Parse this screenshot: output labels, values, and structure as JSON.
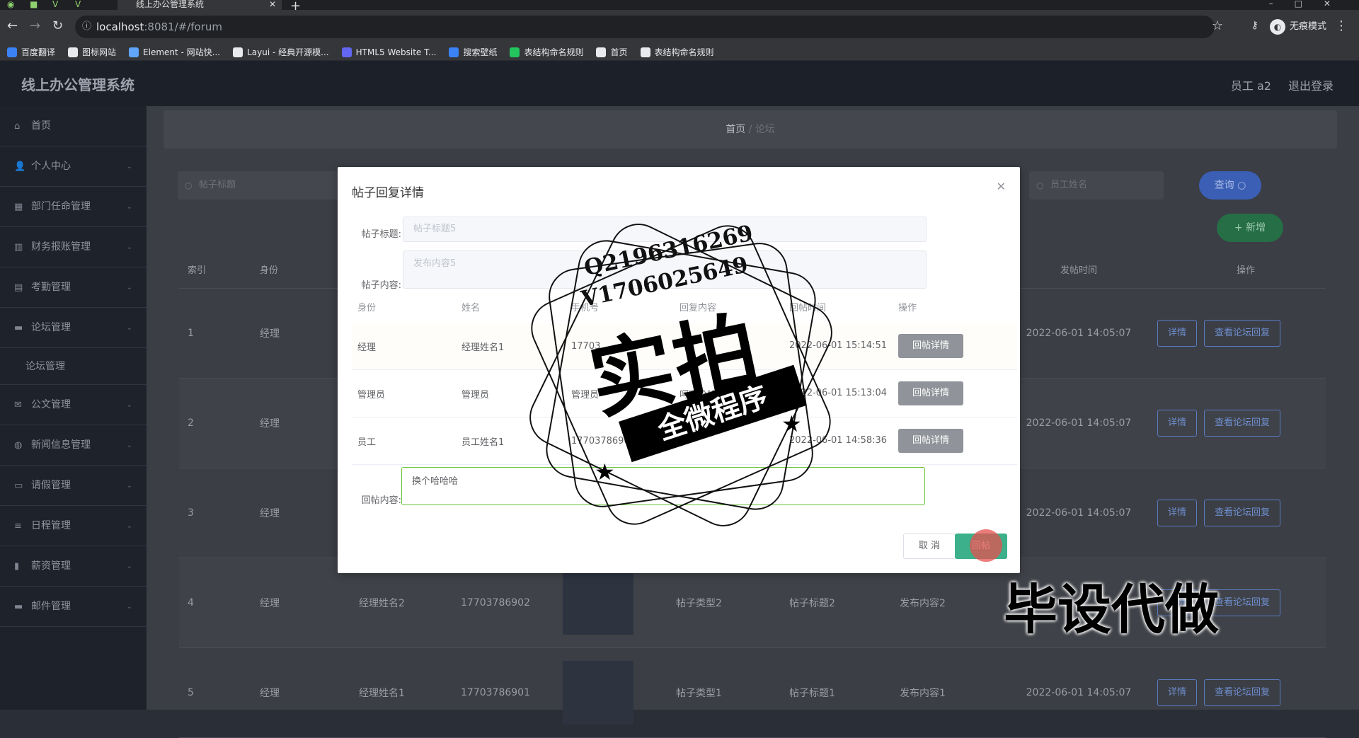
{
  "browser": {
    "tab_title": "线上办公管理系统",
    "url_host": "localhost",
    "url_path": ":8081/#/forum",
    "incognito_label": "无痕模式",
    "bookmarks": [
      {
        "label": "百度翻译",
        "color": "#3b82f6"
      },
      {
        "label": "图标网站",
        "color": "#e8eaed"
      },
      {
        "label": "Element - 网站快...",
        "color": "#60a5fa"
      },
      {
        "label": "Layui - 经典开源模...",
        "color": "#e8eaed"
      },
      {
        "label": "HTML5 Website T...",
        "color": "#6366f1"
      },
      {
        "label": "搜索壁纸",
        "color": "#3b82f6"
      },
      {
        "label": "表结构命名规则",
        "color": "#22c55e"
      },
      {
        "label": "首页",
        "color": "#e8eaed"
      },
      {
        "label": "表结构命名规则",
        "color": "#e8eaed"
      }
    ]
  },
  "app": {
    "title": "线上办公管理系统",
    "user": "员工 a2",
    "logout": "退出登录"
  },
  "sidebar": {
    "items": [
      {
        "label": "首页",
        "icon": "home-icon"
      },
      {
        "label": "个人中心",
        "icon": "user-icon"
      },
      {
        "label": "部门任命管理",
        "icon": "grid-icon"
      },
      {
        "label": "财务报账管理",
        "icon": "chart-icon"
      },
      {
        "label": "考勤管理",
        "icon": "calendar-icon"
      },
      {
        "label": "论坛管理",
        "icon": "forum-icon"
      },
      {
        "label": "论坛管理",
        "icon": ""
      },
      {
        "label": "公文管理",
        "icon": "mail-icon"
      },
      {
        "label": "新闻信息管理",
        "icon": "news-icon"
      },
      {
        "label": "请假管理",
        "icon": "leave-icon"
      },
      {
        "label": "日程管理",
        "icon": "list-icon"
      },
      {
        "label": "薪资管理",
        "icon": "salary-icon"
      },
      {
        "label": "邮件管理",
        "icon": "message-icon"
      }
    ]
  },
  "breadcrumb": {
    "home": "首页",
    "current": "论坛"
  },
  "filters": {
    "title_placeholder": "帖子标题",
    "employee_placeholder": "员工姓名",
    "query_label": "查询",
    "add_label": "+ 新增"
  },
  "table": {
    "headers": [
      "索引",
      "身份",
      "",
      "",
      "",
      "",
      "",
      "",
      "发帖时间",
      "操作"
    ],
    "rows": [
      {
        "idx": "1",
        "role": "经理",
        "name": "",
        "phone": "",
        "type": "",
        "title": "",
        "content": "",
        "time": "2022-06-01 14:05:07"
      },
      {
        "idx": "2",
        "role": "经理",
        "name": "",
        "phone": "",
        "type": "",
        "title": "",
        "content": "",
        "time": "2022-06-01 14:05:07"
      },
      {
        "idx": "3",
        "role": "经理",
        "name": "",
        "phone": "",
        "type": "",
        "title": "",
        "content": "",
        "time": "2022-06-01 14:05:07"
      },
      {
        "idx": "4",
        "role": "经理",
        "name": "经理姓名2",
        "phone": "17703786902",
        "type": "帖子类型2",
        "title": "帖子标题2",
        "content": "发布内容2",
        "time": ""
      },
      {
        "idx": "5",
        "role": "经理",
        "name": "经理姓名1",
        "phone": "17703786901",
        "type": "帖子类型1",
        "title": "帖子标题1",
        "content": "发布内容1",
        "time": "2022-06-01 14:05:07"
      }
    ],
    "detail_label": "详情",
    "view_reply_label": "查看论坛回复"
  },
  "modal": {
    "title": "帖子回复详情",
    "post_title_label": "帖子标题:",
    "post_title_value": "帖子标题5",
    "post_content_label": "帖子内容:",
    "post_content_value": "发布内容5",
    "headers": [
      "身份",
      "姓名",
      "手机号",
      "回复内容",
      "回帖时间",
      "操作"
    ],
    "rows": [
      {
        "role": "经理",
        "name": "经理姓名1",
        "phone": "17703",
        "reply": "",
        "time": "2022-06-01 15:14:51"
      },
      {
        "role": "管理员",
        "name": "管理员",
        "phone": "管理员",
        "reply": "呵呵哈哈",
        "time": "2022-06-01 15:13:04"
      },
      {
        "role": "员工",
        "name": "员工姓名1",
        "phone": "17703786901",
        "reply": "",
        "time": "2022-06-01 14:58:36"
      }
    ],
    "row_button": "回帖详情",
    "reply_label": "回帖内容:",
    "reply_value": "换个哈哈哈",
    "cancel": "取 消",
    "submit": "回帖"
  },
  "watermark": {
    "line1": "Q2196316269",
    "line2": "V1706025649",
    "big": "实拍",
    "band": "全微程序",
    "corner": "毕设代做"
  }
}
